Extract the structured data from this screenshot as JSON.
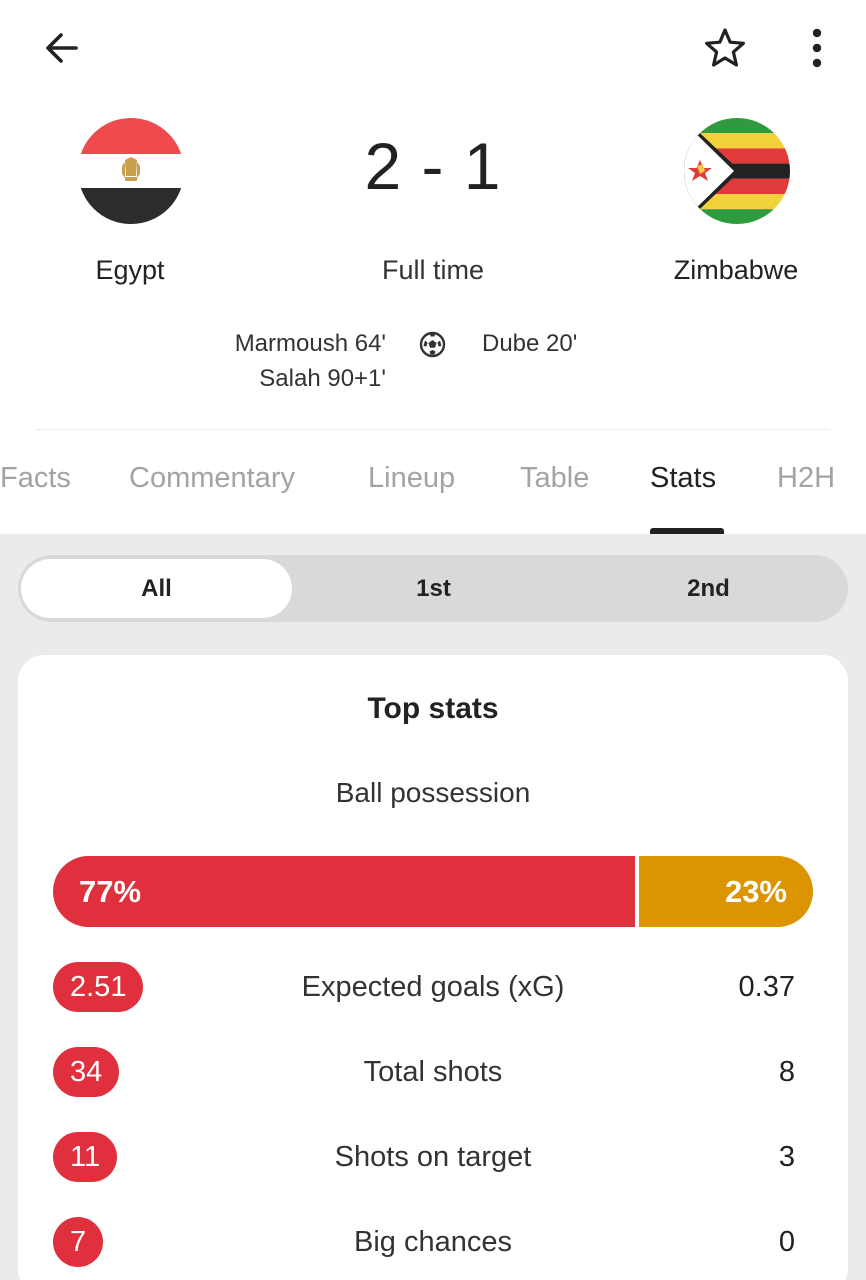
{
  "topbar": {
    "back_icon": "arrow-left-icon",
    "favorite_icon": "star-outline-icon",
    "more_icon": "more-vertical-icon"
  },
  "match": {
    "home_team": "Egypt",
    "away_team": "Zimbabwe",
    "score": "2 - 1",
    "status": "Full time",
    "goal_icon": "soccer-ball-icon",
    "home_scorers": [
      "Marmoush 64'",
      "Salah 90+1'"
    ],
    "away_scorers": [
      "Dube 20'"
    ]
  },
  "tabs": [
    {
      "label": "Facts",
      "active": false
    },
    {
      "label": "Commentary",
      "active": false
    },
    {
      "label": "Lineup",
      "active": false
    },
    {
      "label": "Table",
      "active": false
    },
    {
      "label": "Stats",
      "active": true
    },
    {
      "label": "H2H",
      "active": false
    }
  ],
  "period_filter": {
    "options": [
      "All",
      "1st",
      "2nd"
    ],
    "selected": "All"
  },
  "top_stats": {
    "title": "Top stats",
    "possession": {
      "label": "Ball possession",
      "home_value": 77,
      "away_value": 23,
      "home_label": "77%",
      "away_label": "23%"
    },
    "rows": [
      {
        "home": "2.51",
        "label": "Expected goals (xG)",
        "away": "0.37"
      },
      {
        "home": "34",
        "label": "Total shots",
        "away": "8"
      },
      {
        "home": "11",
        "label": "Shots on target",
        "away": "3"
      },
      {
        "home": "7",
        "label": "Big chances",
        "away": "0"
      }
    ]
  },
  "colors": {
    "home_accent": "#e0303d",
    "away_accent": "#dc9400",
    "inactive_tab": "#a3a3a3"
  }
}
